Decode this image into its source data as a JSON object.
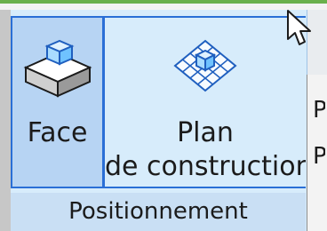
{
  "ribbon": {
    "buttons": [
      {
        "label_line1": "Face",
        "label_line2": "",
        "icon": "cube-face-icon",
        "active": true
      },
      {
        "label_line1": "Plan",
        "label_line2": "de construction",
        "icon": "construction-plane-icon",
        "active": false
      }
    ],
    "group_label": "Positionnement"
  },
  "colors": {
    "accent_border": "#2a6fd6",
    "panel_bg": "#d7ecfb",
    "active_bg": "#b7d4f3",
    "title_green": "#6ab04c"
  },
  "menu_peek": {
    "items": [
      "P",
      "P"
    ]
  }
}
